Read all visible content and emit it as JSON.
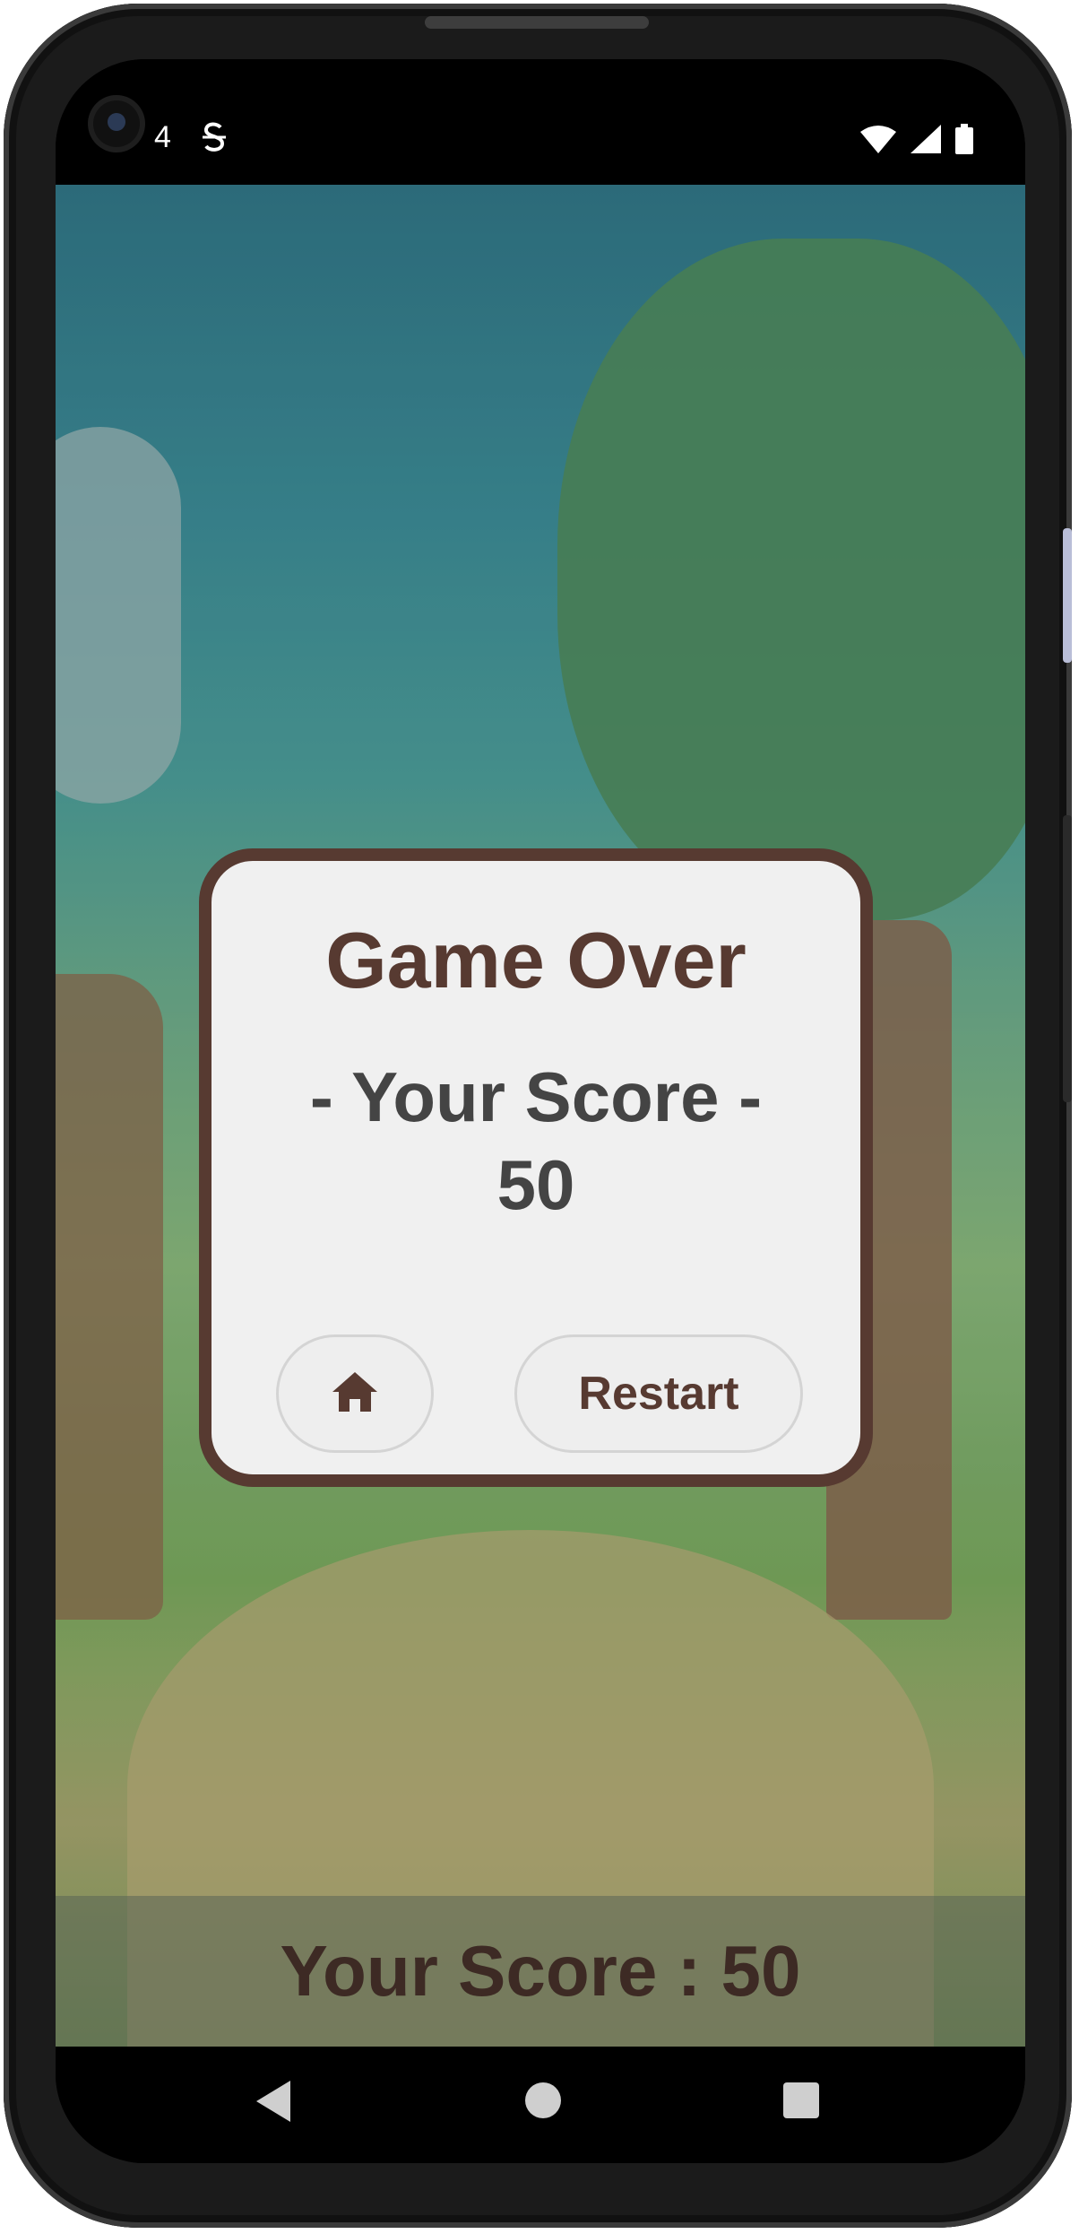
{
  "status_bar": {
    "time_fragment": "4",
    "notification_icon": "sim-s-icon",
    "icons": [
      "wifi-icon",
      "signal-icon",
      "battery-icon"
    ]
  },
  "dialog": {
    "title": "Game Over",
    "score_caption": "- Your Score -",
    "score_value": "50",
    "home_icon": "home-icon",
    "restart_label": "Restart"
  },
  "score_bar": {
    "text": "Your Score : 50"
  },
  "nav": {
    "buttons": [
      "back-icon",
      "home-circle-icon",
      "recents-icon"
    ]
  },
  "colors": {
    "accent": "#573a31",
    "text_gray": "#444444",
    "dialog_bg": "#f0f0f0"
  }
}
